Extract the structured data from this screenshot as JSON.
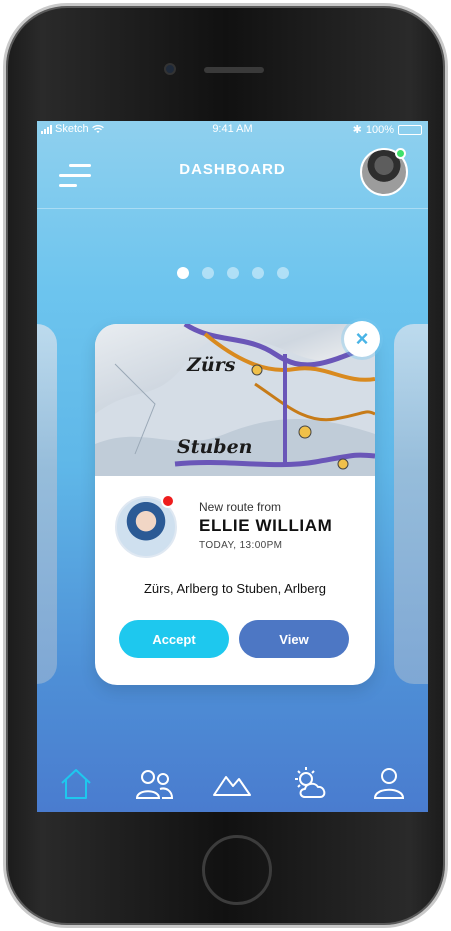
{
  "status_bar": {
    "carrier": "Sketch",
    "time": "9:41 AM",
    "battery": "100%"
  },
  "header": {
    "title": "DASHBOARD",
    "menu_icon": "hamburger-menu-icon",
    "avatar_icon": "user-avatar"
  },
  "pager": {
    "count": 5,
    "active_index": 0
  },
  "card": {
    "map_labels": [
      "Zürs",
      "Stuben"
    ],
    "sender_prefix": "New route from",
    "sender_name": "ELLIE WILLIAM",
    "timestamp": "TODAY, 13:00PM",
    "route": "Zürs, Arlberg to Stuben, Arlberg",
    "accept_label": "Accept",
    "view_label": "View",
    "close_icon": "close-icon"
  },
  "tabbar": {
    "items": [
      {
        "name": "home-icon",
        "active": true
      },
      {
        "name": "friends-icon",
        "active": false
      },
      {
        "name": "mountains-icon",
        "active": false
      },
      {
        "name": "weather-icon",
        "active": false
      },
      {
        "name": "profile-icon",
        "active": false
      }
    ]
  },
  "colors": {
    "accent": "#1ec8ee",
    "view_button": "#4d77c4",
    "active_tab": "#1ec8ee",
    "notification": "#ee1d1d",
    "online": "#3ee06b"
  }
}
